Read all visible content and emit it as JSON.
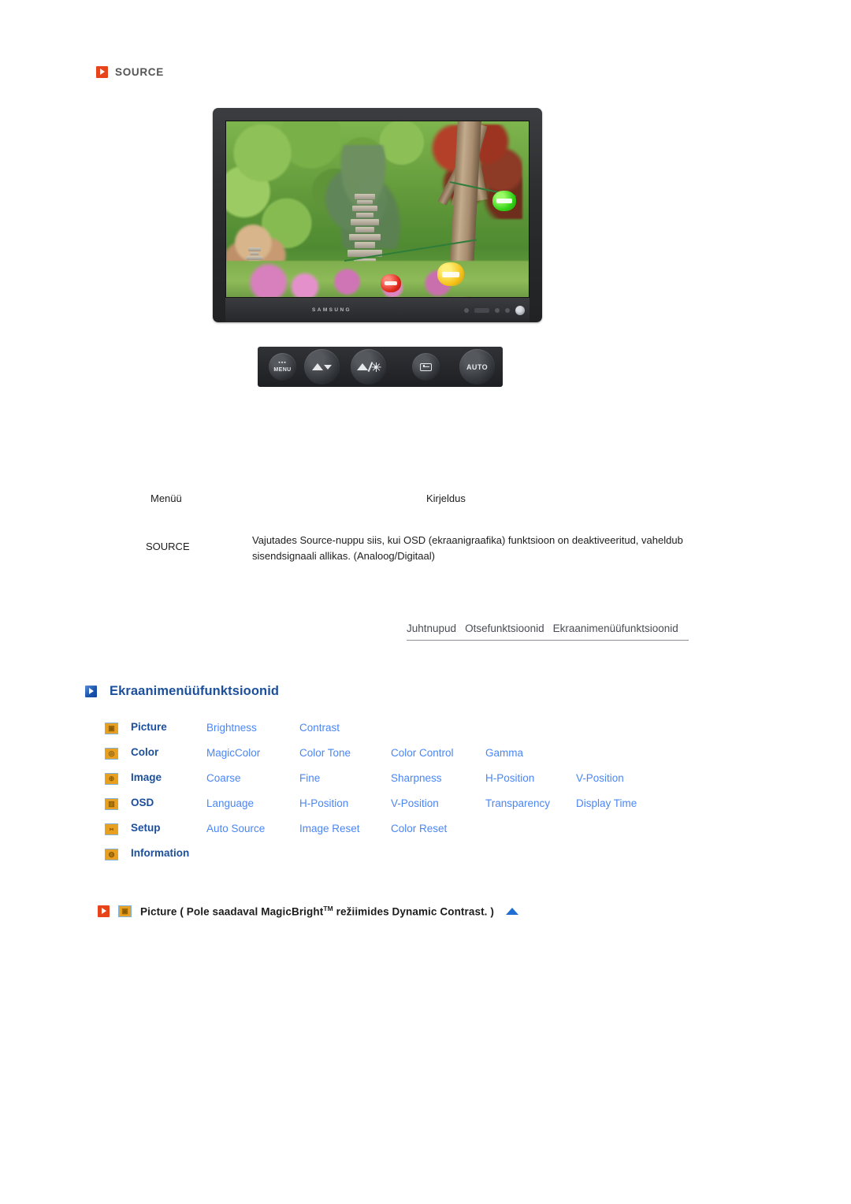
{
  "source_section": {
    "icon": "red-play-square-icon",
    "title": "SOURCE"
  },
  "monitor": {
    "brand": "SAMSUNG",
    "screen_content": "garden scene with stone pagodas, trees and paper lanterns"
  },
  "control_buttons": [
    {
      "name": "menu-button",
      "label": "MENU",
      "glyph": "osd-menu-icon"
    },
    {
      "name": "down-button",
      "label": "",
      "glyph": "volume-down-icon"
    },
    {
      "name": "brightness-button",
      "label": "",
      "glyph": "brightness-icon"
    },
    {
      "name": "enter-button",
      "label": "",
      "glyph": "enter-source-icon"
    },
    {
      "name": "auto-button",
      "label": "AUTO",
      "glyph": "auto-text-icon"
    }
  ],
  "table": {
    "headers": {
      "menu": "Menüü",
      "description": "Kirjeldus"
    },
    "rows": [
      {
        "menu": "SOURCE",
        "description": "Vajutades Source-nuppu siis, kui OSD (ekraanigraafika) funktsioon on deaktiveeritud, vaheldub sisendsignaali allikas. (Analoog/Digitaal)"
      }
    ]
  },
  "nav_tabs": [
    {
      "label": "Juhtnupud"
    },
    {
      "label": "Otsefunktsioonid"
    },
    {
      "label": "Ekraanimenüüfunktsioonid"
    }
  ],
  "heading": {
    "icon": "blue-play-square-icon",
    "text": "Ekraanimenüüfunktsioonid"
  },
  "menu_matrix": [
    {
      "icon": "picture-icon",
      "glyph": "▣",
      "category": "Picture",
      "items": [
        "Brightness",
        "Contrast"
      ]
    },
    {
      "icon": "color-icon",
      "glyph": "◎",
      "category": "Color",
      "items": [
        "MagicColor",
        "Color Tone",
        "Color Control",
        "Gamma"
      ]
    },
    {
      "icon": "image-icon",
      "glyph": "⊕",
      "category": "Image",
      "items": [
        "Coarse",
        "Fine",
        "Sharpness",
        "H-Position",
        "V-Position"
      ]
    },
    {
      "icon": "osd-icon",
      "glyph": "▥",
      "category": "OSD",
      "items": [
        "Language",
        "H-Position",
        "V-Position",
        "Transparency",
        "Display Time"
      ]
    },
    {
      "icon": "setup-icon",
      "glyph": "⑅",
      "category": "Setup",
      "items": [
        "Auto Source",
        "Image Reset",
        "Color Reset"
      ]
    },
    {
      "icon": "information-icon",
      "glyph": "◍",
      "category": "Information",
      "items": []
    }
  ],
  "footer": {
    "bullet_icon": "red-play-square-icon",
    "menu_icon": "picture-icon",
    "glyph": "▣",
    "text_before": "Picture ( Pole saadaval MagicBright",
    "trademark": "TM",
    "text_after": " režiimides Dynamic Contrast. )",
    "scroll_icon": "scroll-to-top-triangle-icon"
  },
  "colors": {
    "accent_red": "#e8441c",
    "accent_blue": "#1b4f9c",
    "link_blue": "#4a86f7",
    "icon_orange": "#e8a020"
  }
}
